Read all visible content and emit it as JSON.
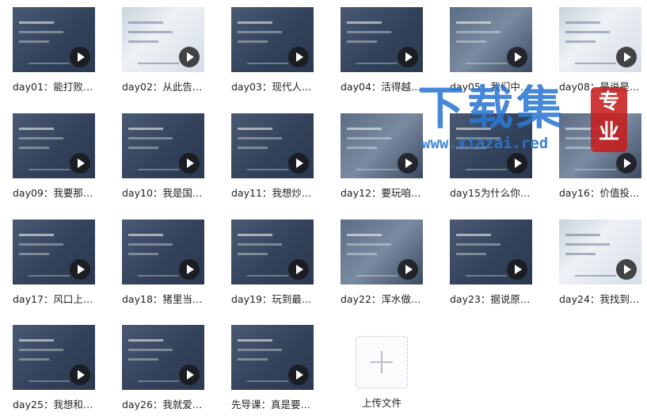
{
  "files": [
    {
      "label": "day01：能打败…",
      "style": "dark"
    },
    {
      "label": "day02：从此告…",
      "style": "light"
    },
    {
      "label": "day03：现代人…",
      "style": "dark"
    },
    {
      "label": "day04：活得越…",
      "style": "dark"
    },
    {
      "label": "day05：我们中…",
      "style": "photo"
    },
    {
      "label": "day08：是说是…",
      "style": "light"
    },
    {
      "label": "day09：我要那…",
      "style": "dark"
    },
    {
      "label": "day10：我是国…",
      "style": "dark"
    },
    {
      "label": "day11：我想炒…",
      "style": "dark"
    },
    {
      "label": "day12：要玩咱…",
      "style": "photo"
    },
    {
      "label": "day15为什么你…",
      "style": "dark"
    },
    {
      "label": "day16：价值投…",
      "style": "photo"
    },
    {
      "label": "day17：风口上…",
      "style": "dark"
    },
    {
      "label": "day18：猪里当…",
      "style": "dark"
    },
    {
      "label": "day19：玩到最…",
      "style": "dark"
    },
    {
      "label": "day22：浑水做…",
      "style": "photo"
    },
    {
      "label": "day23：据说原…",
      "style": "dark"
    },
    {
      "label": "day24：我找到…",
      "style": "light"
    },
    {
      "label": "day25：我想和…",
      "style": "dark"
    },
    {
      "label": "day26：我就爱…",
      "style": "dark"
    },
    {
      "label": "先导课：真是要…",
      "style": "dark"
    }
  ],
  "upload": {
    "label": "上传文件"
  },
  "watermark": {
    "main": "下载集",
    "url": "www.xiazai.red",
    "seal": "专业"
  }
}
